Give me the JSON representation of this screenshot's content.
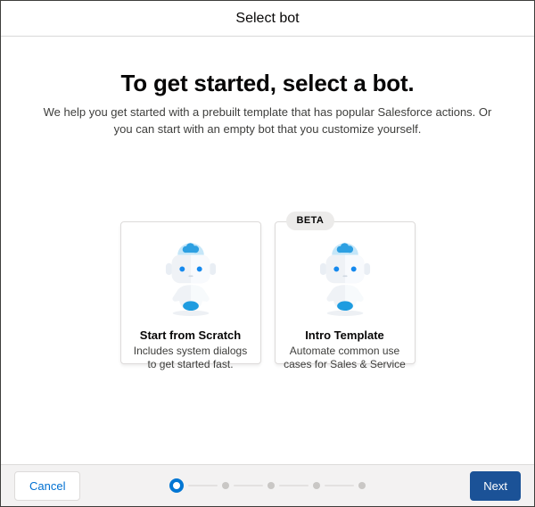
{
  "header": {
    "title": "Select bot"
  },
  "main": {
    "heading": "To get started, select a bot.",
    "subheading": "We help you get started with a prebuilt template that has popular Salesforce actions. Or you can start with an empty bot that you customize yourself.",
    "cards": [
      {
        "title": "Start from Scratch",
        "description": "Includes system dialogs to get started fast.",
        "icon": "einstein-bot-illustration"
      },
      {
        "title": "Intro Template",
        "description": "Automate common use cases for Sales & Service",
        "badge": "BETA",
        "icon": "einstein-bot-illustration"
      }
    ]
  },
  "footer": {
    "cancel_label": "Cancel",
    "next_label": "Next",
    "progress": {
      "total_steps": 5,
      "current_step": 1
    }
  },
  "colors": {
    "link_blue": "#0070d2",
    "next_button_blue": "#1b5297",
    "active_step_blue": "#0176d3",
    "inactive_step_gray": "#c9c7c5",
    "bot_blue": "#1e9ce0",
    "footer_bg": "#f3f2f2",
    "card_border": "#dddbda"
  }
}
